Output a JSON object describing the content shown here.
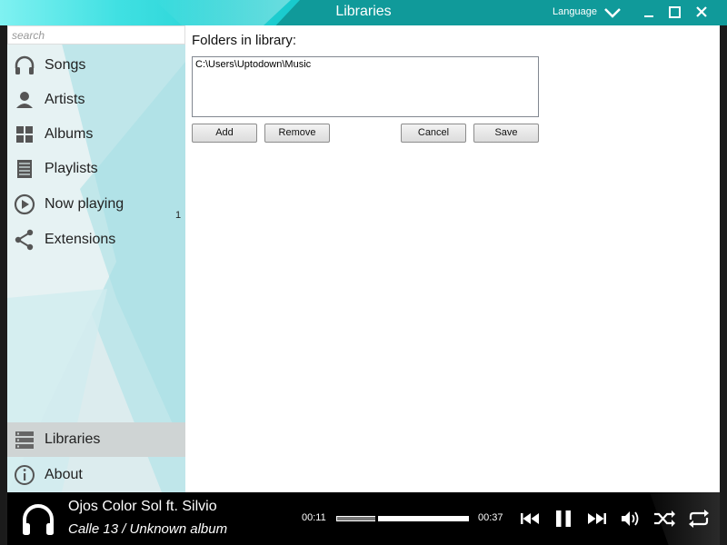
{
  "window": {
    "title": "Libraries",
    "language_label": "Language"
  },
  "sidebar": {
    "search_placeholder": "search",
    "items": [
      {
        "label": "Songs",
        "icon": "headphones-icon"
      },
      {
        "label": "Artists",
        "icon": "person-icon"
      },
      {
        "label": "Albums",
        "icon": "grid-icon"
      },
      {
        "label": "Playlists",
        "icon": "list-icon"
      },
      {
        "label": "Now playing",
        "icon": "play-circle-icon"
      },
      {
        "label": "Extensions",
        "icon": "share-icon"
      }
    ],
    "now_playing_count": "1",
    "bottom_items": [
      {
        "label": "Libraries",
        "icon": "library-icon",
        "active": true
      },
      {
        "label": "About",
        "icon": "info-icon"
      }
    ]
  },
  "content": {
    "heading": "Folders in library:",
    "folders": [
      "C:\\Users\\Uptodown\\Music"
    ],
    "buttons": {
      "add": "Add",
      "remove": "Remove",
      "cancel": "Cancel",
      "save": "Save"
    }
  },
  "player": {
    "track_title": "Ojos Color Sol ft. Silvio",
    "track_sub": "Calle 13 / Unknown album",
    "elapsed": "00:11",
    "duration": "00:37",
    "progress_fraction": 0.3
  },
  "colors": {
    "accent": "#109a9a",
    "accent_light": "#3fe0e2",
    "sidebar_bg": "#dcecee"
  }
}
